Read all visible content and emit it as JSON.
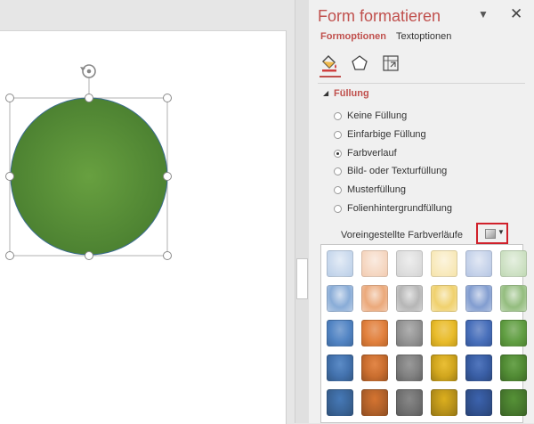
{
  "pane": {
    "title": "Form formatieren",
    "menu_icon": "triangle-down-icon",
    "close_icon": "close-icon",
    "tabs": [
      {
        "label": "Formoptionen",
        "active": true
      },
      {
        "label": "Textoptionen",
        "active": false
      }
    ],
    "categories": [
      "fill-line-icon",
      "effects-pentagon-icon",
      "size-properties-icon"
    ]
  },
  "fill_section": {
    "title": "Füllung",
    "options": [
      {
        "label": "Keine Füllung",
        "checked": false
      },
      {
        "label": "Einfarbige Füllung",
        "checked": false
      },
      {
        "label": "Farbverlauf",
        "checked": true
      },
      {
        "label": "Bild- oder Texturfüllung",
        "checked": false
      },
      {
        "label": "Musterfüllung",
        "checked": false
      },
      {
        "label": "Folienhintergrundfüllung",
        "checked": false
      }
    ],
    "preset_label": "Voreingestellte Farbverläufe"
  },
  "canvas": {
    "shape": "circle",
    "shape_color": "#5a8f3a",
    "rotate_icon": "rotate-handle-icon"
  },
  "gradient_palette": {
    "columns": [
      {
        "name": "blue",
        "base": "#4a7fc1"
      },
      {
        "name": "orange",
        "base": "#e07a34"
      },
      {
        "name": "gray",
        "base": "#8f8f8f"
      },
      {
        "name": "gold",
        "base": "#e8b820"
      },
      {
        "name": "navy",
        "base": "#3f68b7"
      },
      {
        "name": "green",
        "base": "#5a9a3a"
      }
    ],
    "rows": 5
  },
  "colors": {
    "accent": "#c0504d",
    "highlight_border": "#d0202a"
  }
}
